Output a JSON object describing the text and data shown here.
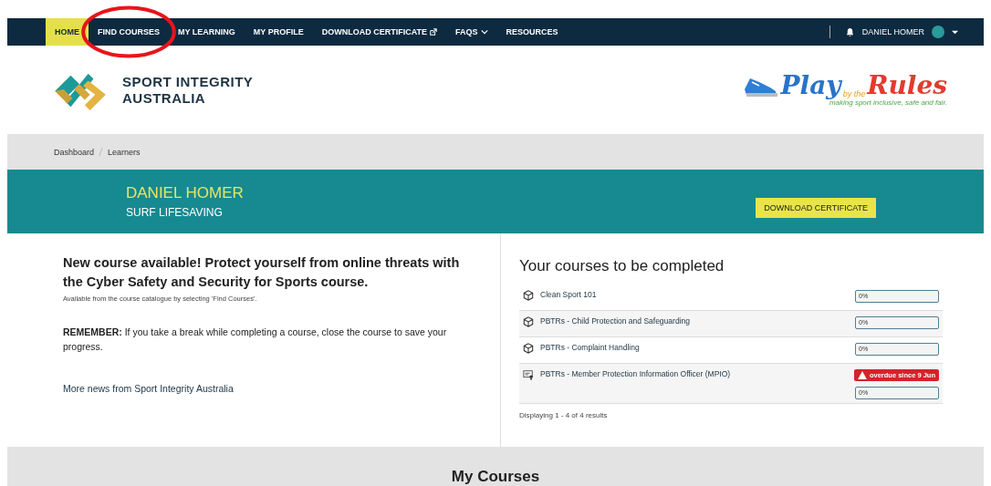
{
  "nav": {
    "items": [
      {
        "label": "HOME",
        "selected": true,
        "dropdown": false,
        "external": false,
        "circled": false
      },
      {
        "label": "FIND COURSES",
        "selected": false,
        "dropdown": false,
        "external": false,
        "circled": true
      },
      {
        "label": "MY LEARNING",
        "selected": false,
        "dropdown": false,
        "external": false,
        "circled": false
      },
      {
        "label": "MY PROFILE",
        "selected": false,
        "dropdown": false,
        "external": false,
        "circled": false
      },
      {
        "label": "DOWNLOAD CERTIFICATE",
        "selected": false,
        "dropdown": false,
        "external": true,
        "circled": false
      },
      {
        "label": "FAQS",
        "selected": false,
        "dropdown": true,
        "external": false,
        "circled": false
      },
      {
        "label": "RESOURCES",
        "selected": false,
        "dropdown": false,
        "external": false,
        "circled": false
      }
    ],
    "user": "DANIEL HOMER"
  },
  "brand": {
    "name_lines": [
      "SPORT INTEGRITY",
      "AUSTRALIA"
    ],
    "partner": {
      "word1": "Play",
      "word2": "by the",
      "word3": "Rules",
      "tagline": "making sport inclusive, safe and fair."
    }
  },
  "breadcrumb": [
    "Dashboard",
    "Learners"
  ],
  "banner": {
    "name": "DANIEL HOMER",
    "organisation": "SURF LIFESAVING",
    "button": "DOWNLOAD CERTIFICATE"
  },
  "news": {
    "heading": "New course available! Protect yourself from online threats with the Cyber Safety and Security for Sports course.",
    "note": "Available from the course catalogue by selecting 'Find Courses'.",
    "reminder": "**REMEMBER:** If you take a break while completing a course, close the course to save your progress.",
    "link": "More news from Sport Integrity Australia"
  },
  "courses": {
    "heading": "Your courses to be completed",
    "items": [
      {
        "kind": "package",
        "title": "Clean Sport 101",
        "level": 0,
        "reading": "0%"
      },
      {
        "kind": "package",
        "title": "PBTRs - Child Protection and Safeguarding",
        "level": 0,
        "reading": "0%"
      },
      {
        "kind": "package",
        "title": "PBTRs - Complaint Handling",
        "level": 0,
        "reading": "0%"
      },
      {
        "kind": "certificate",
        "title": "PBTRs - Member Protection Information Officer (MPIO)",
        "level": 0,
        "reading": "0%",
        "overdue": "overdue since 9 Jun"
      }
    ],
    "summary": "Displaying 1 - 4 of 4 results"
  },
  "my_courses": {
    "heading": "My Courses"
  }
}
